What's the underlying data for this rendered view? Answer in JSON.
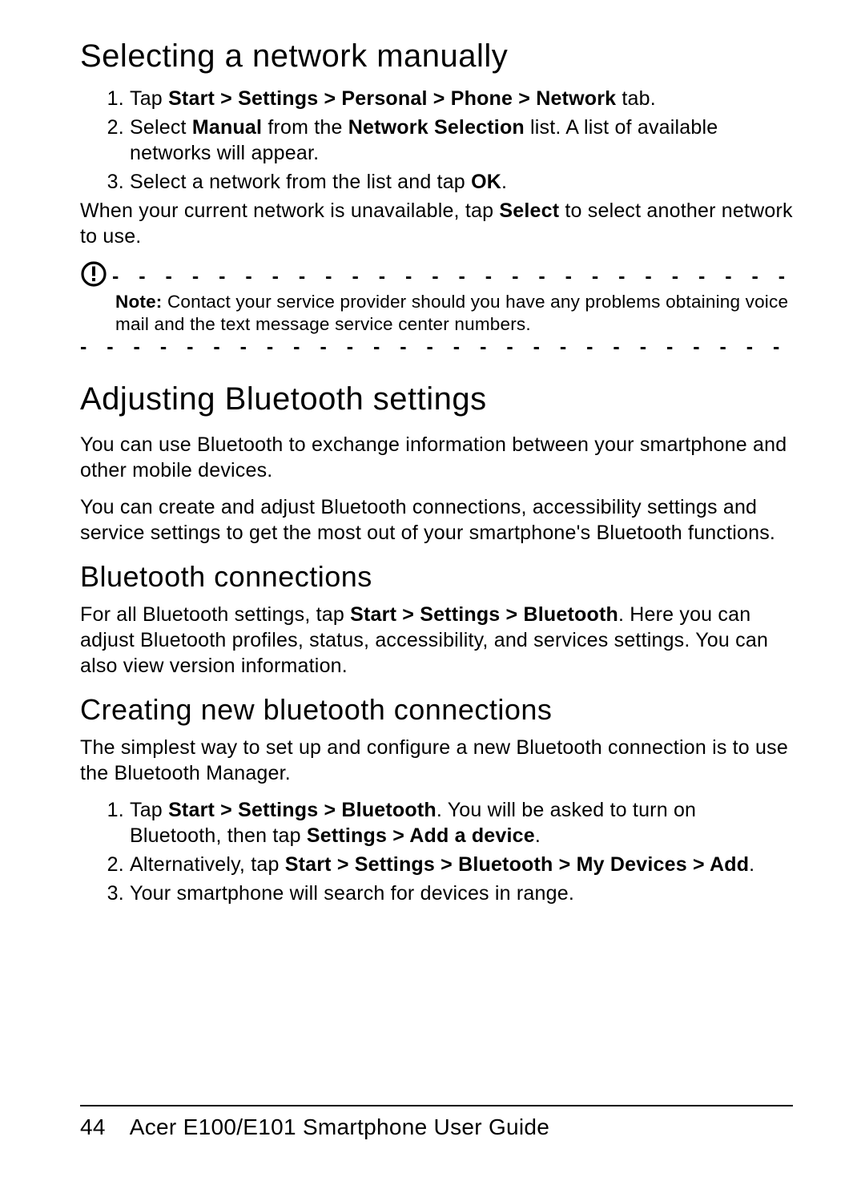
{
  "heading_select_network": "Selecting a network manually",
  "ol_network": {
    "item1_pre": "Tap ",
    "item1_bold": "Start > Settings > Personal > Phone > Network",
    "item1_post": " tab.",
    "item2_pre": "Select ",
    "item2_b1": "Manual",
    "item2_mid": " from the ",
    "item2_b2": "Network Selection",
    "item2_post": " list. A list of available networks will appear.",
    "item3_pre": "Select a network from the list and tap ",
    "item3_bold": "OK",
    "item3_post": "."
  },
  "network_after_pre": "When your current network is unavailable, tap ",
  "network_after_bold": "Select",
  "network_after_post": " to select another network to use.",
  "note_label": "Note:",
  "note_text": " Contact your service provider should you have any problems obtaining voice mail and the text message service center numbers.",
  "dash_row": "- - - - - - - - - - - - - - - - - - - - - - - - - - - - - - - - - - - - -",
  "heading_bluetooth": "Adjusting Bluetooth settings",
  "bt_para1": "You can use Bluetooth to exchange information between your smartphone and other mobile devices.",
  "bt_para2": "You can create and adjust Bluetooth connections, accessibility settings and service settings to get the most out of your smartphone's Bluetooth functions.",
  "heading_bt_conn": "Bluetooth connections",
  "bt_conn_pre": "For all Bluetooth settings, tap ",
  "bt_conn_bold": "Start > Settings > Bluetooth",
  "bt_conn_post": ". Here you can adjust Bluetooth profiles, status, accessibility, and services settings. You can also view version information.",
  "heading_bt_new": "Creating new bluetooth connections",
  "bt_new_intro": "The simplest way to set up and configure a new Bluetooth connection is to use the Bluetooth Manager.",
  "ol_bt": {
    "item1_pre": "Tap ",
    "item1_b1": "Start > Settings > Bluetooth",
    "item1_mid": ". You will be asked to turn on Bluetooth, then tap ",
    "item1_b2": "Settings > Add a device",
    "item1_post": ".",
    "item2_pre": "Alternatively, tap ",
    "item2_b1": "Start > Settings > Bluetooth > My Devices > Add",
    "item2_post": ".",
    "item3": "Your smartphone will search for devices in range."
  },
  "footer_page": "44",
  "footer_title": "Acer E100/E101 Smartphone User Guide"
}
